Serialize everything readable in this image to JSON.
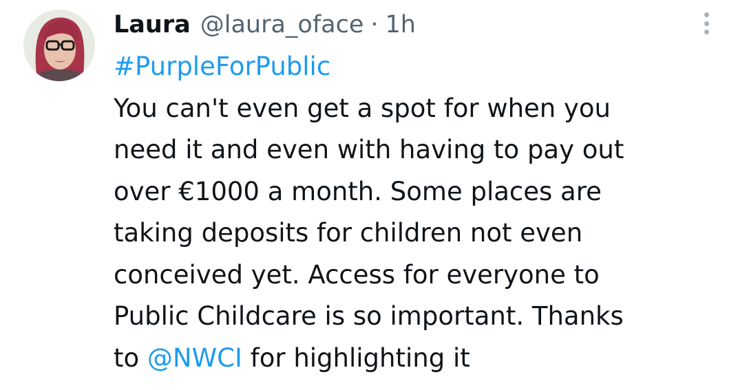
{
  "tweet": {
    "author_name": "Laura",
    "author_handle": "@laura_oface",
    "separator": "·",
    "timestamp": "1h",
    "hashtag": "#PurpleForPublic",
    "lines": [
      "You can't even get a spot for when you",
      "need it and even with having to pay out",
      "over €1000 a month. Some places are",
      "taking deposits for children not even",
      "conceived yet. Access for everyone to",
      "Public Childcare is so important. Thanks"
    ],
    "last_line_prefix": "to ",
    "mention": "@NWCI",
    "last_line_suffix": " for highlighting it"
  },
  "icons": {
    "more": "more-vertical-icon",
    "avatar": "avatar"
  },
  "colors": {
    "text": "#0f1419",
    "secondary": "#536471",
    "link": "#1d9bf0",
    "hair": "#b0394f",
    "background": "#ffffff"
  }
}
